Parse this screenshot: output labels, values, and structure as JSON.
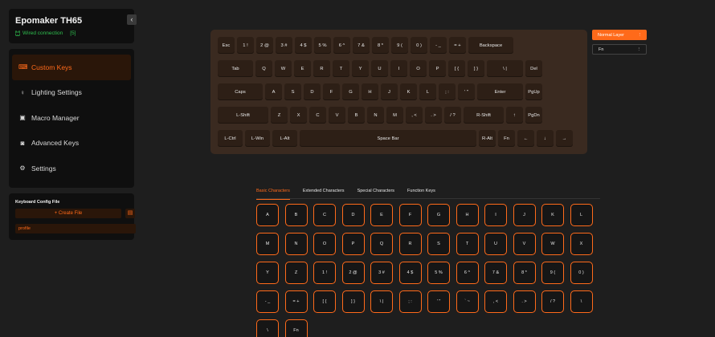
{
  "device": {
    "name": "Epomaker TH65",
    "connection": "Wired connection",
    "battery": "[5]",
    "conn_icon": "plug-icon",
    "collapse_glyph": "‹"
  },
  "nav": {
    "items": [
      {
        "label": "Custom Keys",
        "icon": "⌨",
        "active": true
      },
      {
        "label": "Lighting Settings",
        "icon": "♀",
        "active": false
      },
      {
        "label": "Macro Manager",
        "icon": "▣",
        "active": false
      },
      {
        "label": "Advanced Keys",
        "icon": "◙",
        "active": false
      },
      {
        "label": "Settings",
        "icon": "⚙",
        "active": false
      }
    ]
  },
  "config": {
    "title": "Keyboard Config File",
    "create_label": "+ Create File",
    "file_icon": "▤",
    "profile": "profile"
  },
  "keyboard": {
    "rows": [
      [
        {
          "label": "Esc",
          "w": 21
        },
        {
          "label": "1 !",
          "w": 21
        },
        {
          "label": "2 @",
          "w": 21
        },
        {
          "label": "3 #",
          "w": 21
        },
        {
          "label": "4 $",
          "w": 21
        },
        {
          "label": "5 %",
          "w": 21
        },
        {
          "label": "6 ^",
          "w": 21
        },
        {
          "label": "7 &",
          "w": 21
        },
        {
          "label": "8 *",
          "w": 21
        },
        {
          "label": "9 (",
          "w": 21
        },
        {
          "label": "0 )",
          "w": 21
        },
        {
          "label": "- _",
          "w": 21
        },
        {
          "label": "= +",
          "w": 21
        },
        {
          "label": "Backspace",
          "w": 56
        }
      ],
      [
        {
          "label": "Tab",
          "w": 44
        },
        {
          "label": "Q",
          "w": 21
        },
        {
          "label": "W",
          "w": 21
        },
        {
          "label": "E",
          "w": 21
        },
        {
          "label": "R",
          "w": 21
        },
        {
          "label": "T",
          "w": 21
        },
        {
          "label": "Y",
          "w": 21
        },
        {
          "label": "U",
          "w": 21
        },
        {
          "label": "I",
          "w": 21
        },
        {
          "label": "O",
          "w": 21
        },
        {
          "label": "P",
          "w": 21
        },
        {
          "label": "[ {",
          "w": 21
        },
        {
          "label": "] }",
          "w": 21
        },
        {
          "label": "\\ |",
          "w": 45
        },
        {
          "label": "Del",
          "w": 21
        }
      ],
      [
        {
          "label": "Caps",
          "w": 56
        },
        {
          "label": "A",
          "w": 21
        },
        {
          "label": "S",
          "w": 21
        },
        {
          "label": "D",
          "w": 21
        },
        {
          "label": "F",
          "w": 21
        },
        {
          "label": "G",
          "w": 21
        },
        {
          "label": "H",
          "w": 21
        },
        {
          "label": "J",
          "w": 21
        },
        {
          "label": "K",
          "w": 21
        },
        {
          "label": "L",
          "w": 21
        },
        {
          "label": "; :",
          "w": 21
        },
        {
          "label": "' \"",
          "w": 21
        },
        {
          "label": "Enter",
          "w": 57
        },
        {
          "label": "PgUp",
          "w": 21
        }
      ],
      [
        {
          "label": "L-Shift",
          "w": 63
        },
        {
          "label": "Z",
          "w": 21
        },
        {
          "label": "X",
          "w": 21
        },
        {
          "label": "C",
          "w": 21
        },
        {
          "label": "V",
          "w": 21
        },
        {
          "label": "B",
          "w": 21
        },
        {
          "label": "N",
          "w": 21
        },
        {
          "label": "M",
          "w": 21
        },
        {
          "label": ", <",
          "w": 21
        },
        {
          "label": ". >",
          "w": 21
        },
        {
          "label": "/ ?",
          "w": 21
        },
        {
          "label": "R-Shift",
          "w": 50
        },
        {
          "label": "↑",
          "w": 21
        },
        {
          "label": "PgDn",
          "w": 21
        }
      ],
      [
        {
          "label": "L-Ctrl",
          "w": 31
        },
        {
          "label": "L-Win",
          "w": 31
        },
        {
          "label": "L-Alt",
          "w": 31
        },
        {
          "label": "Space Bar",
          "w": 220
        },
        {
          "label": "R-Alt",
          "w": 21
        },
        {
          "label": "Fn",
          "w": 21
        },
        {
          "label": "←",
          "w": 21
        },
        {
          "label": "↓",
          "w": 21
        },
        {
          "label": "→",
          "w": 21
        }
      ]
    ]
  },
  "layers": [
    {
      "label": "Normal Layer",
      "menu": "⋮",
      "active": true
    },
    {
      "label": "Fn",
      "menu": "⋮",
      "active": false
    }
  ],
  "char_tabs": [
    {
      "label": "Basic Characters",
      "active": true
    },
    {
      "label": "Extended Characters",
      "active": false
    },
    {
      "label": "Special Characters",
      "active": false
    },
    {
      "label": "Function Keys",
      "active": false
    }
  ],
  "char_keys": [
    "A",
    "B",
    "C",
    "D",
    "E",
    "F",
    "G",
    "H",
    "I",
    "J",
    "K",
    "L",
    "M",
    "N",
    "O",
    "P",
    "Q",
    "R",
    "S",
    "T",
    "U",
    "V",
    "W",
    "X",
    "Y",
    "Z",
    "1 !",
    "2 @",
    "3 #",
    "4 $",
    "5 %",
    "6 ^",
    "7 &",
    "8 *",
    "9 (",
    "0 )",
    "- _",
    "= +",
    "[ {",
    "] }",
    "\\ |",
    "; :",
    "' \"",
    "` ~",
    ", <",
    ". >",
    "/ ?",
    "\\",
    "\\",
    "Fn"
  ]
}
